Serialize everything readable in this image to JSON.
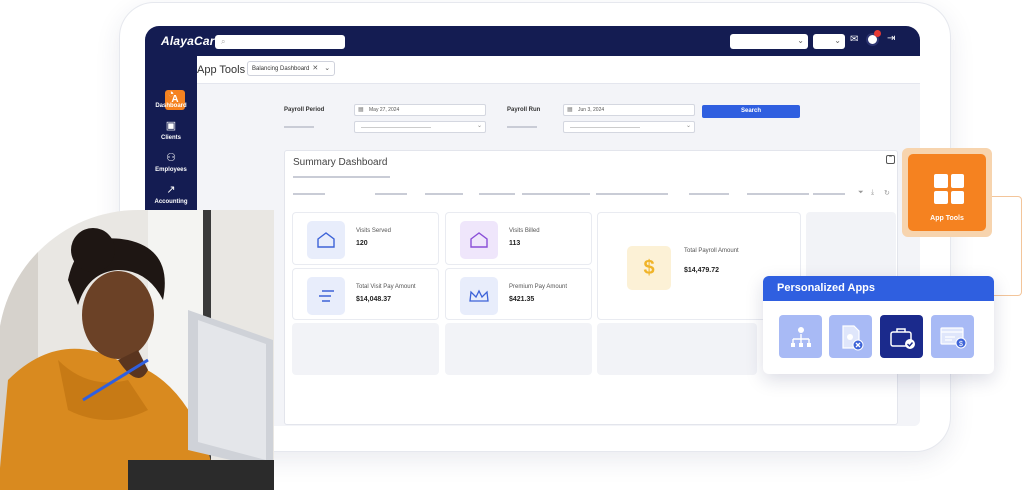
{
  "brand": {
    "logo": "AlayaCare",
    "accent": "#f58220",
    "nav_bg": "#141c52",
    "primary": "#2f5fe0"
  },
  "sidebar": {
    "items": [
      {
        "label": "Dashboard",
        "icon": "gauge-icon"
      },
      {
        "label": "Clients",
        "icon": "id-card-icon"
      },
      {
        "label": "Employees",
        "icon": "people-icon"
      },
      {
        "label": "Accounting",
        "icon": "chart-icon"
      }
    ]
  },
  "header": {
    "title": "App Tools",
    "tab": "Balancing Dashboard"
  },
  "form": {
    "payroll_period_label": "Payroll Period",
    "payroll_period_date": "May 27, 2024",
    "payroll_run_label": "Payroll Run",
    "payroll_run_date": "Jun 3, 2024",
    "search_label": "Search"
  },
  "summary": {
    "title": "Summary Dashboard",
    "cards": [
      {
        "title": "Visits Served",
        "value": "120"
      },
      {
        "title": "Visits Billed",
        "value": "113"
      },
      {
        "title": "Total Visit Pay Amount",
        "value": "$14,048.37"
      },
      {
        "title": "Premium Pay Amount",
        "value": "$421.35"
      },
      {
        "title": "Total Payroll Amount",
        "value": "$14,479.72"
      }
    ]
  },
  "app_tools_tile": {
    "label": "App Tools"
  },
  "personalized_apps": {
    "title": "Personalized Apps",
    "apps": [
      "org-chart-icon",
      "document-remove-icon",
      "briefcase-check-icon",
      "payment-window-icon"
    ]
  }
}
